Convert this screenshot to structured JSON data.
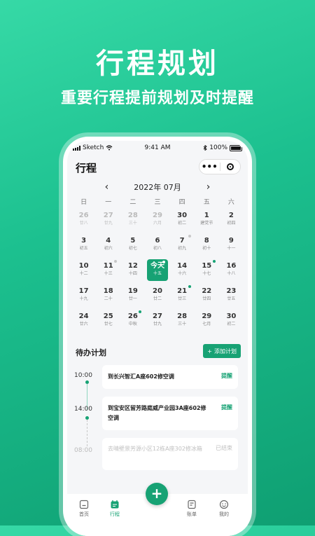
{
  "hero": {
    "title": "行程规划",
    "subtitle": "重要行程提前规划及时提醒"
  },
  "status_bar": {
    "carrier": "Sketch",
    "time": "9:41 AM",
    "battery": "100%"
  },
  "header": {
    "title": "行程",
    "more_icon": "more-dots-icon",
    "record_icon": "record-icon"
  },
  "calendar": {
    "month_label": "2022年 07月",
    "weekdays": [
      "日",
      "一",
      "二",
      "三",
      "四",
      "五",
      "六"
    ],
    "rows": [
      [
        {
          "n": "26",
          "l": "廿八"
        },
        {
          "n": "27",
          "l": "廿九"
        },
        {
          "n": "28",
          "l": "三十"
        },
        {
          "n": "29",
          "l": "六月"
        },
        {
          "n": "30",
          "l": "初二"
        },
        {
          "n": "1",
          "l": "建党节"
        },
        {
          "n": "2",
          "l": "初四"
        }
      ],
      [
        {
          "n": "3",
          "l": "初五"
        },
        {
          "n": "4",
          "l": "初六"
        },
        {
          "n": "5",
          "l": "初七"
        },
        {
          "n": "6",
          "l": "初八"
        },
        {
          "n": "7",
          "l": "初九"
        },
        {
          "n": "8",
          "l": "初十"
        },
        {
          "n": "9",
          "l": "十一"
        }
      ],
      [
        {
          "n": "10",
          "l": "十二"
        },
        {
          "n": "11",
          "l": "十三"
        },
        {
          "n": "12",
          "l": "十四"
        },
        {
          "n": "今天",
          "l": "十五"
        },
        {
          "n": "14",
          "l": "十六"
        },
        {
          "n": "15",
          "l": "十七"
        },
        {
          "n": "16",
          "l": "十八"
        }
      ],
      [
        {
          "n": "17",
          "l": "十九"
        },
        {
          "n": "18",
          "l": "二十"
        },
        {
          "n": "19",
          "l": "廿一"
        },
        {
          "n": "20",
          "l": "廿二"
        },
        {
          "n": "21",
          "l": "廿三"
        },
        {
          "n": "22",
          "l": "廿四"
        },
        {
          "n": "23",
          "l": "廿五"
        }
      ],
      [
        {
          "n": "24",
          "l": "廿六"
        },
        {
          "n": "25",
          "l": "廿七"
        },
        {
          "n": "26",
          "l": "中秋"
        },
        {
          "n": "27",
          "l": "廿九"
        },
        {
          "n": "28",
          "l": "三十"
        },
        {
          "n": "29",
          "l": "七月"
        },
        {
          "n": "30",
          "l": "初二"
        }
      ]
    ]
  },
  "plans": {
    "heading": "待办计划",
    "add_label": "添加计划",
    "items": [
      {
        "time": "10:00",
        "text": "到长兴智汇A座602修空调",
        "action": "提醒"
      },
      {
        "time": "14:00",
        "text": "到宝安区留芳路庭威产业园3A座602修空调",
        "action": "提醒"
      },
      {
        "time": "08:00",
        "text": "去晴壁景芳源小区12栋A座302修冰箱",
        "action": "已结束"
      }
    ]
  },
  "tabbar": {
    "tabs": [
      {
        "label": "首页",
        "icon": "home-icon"
      },
      {
        "label": "行程",
        "icon": "calendar-icon"
      },
      {
        "label": "账单",
        "icon": "bill-icon"
      },
      {
        "label": "我的",
        "icon": "smile-icon"
      }
    ],
    "fab_label": "+"
  },
  "colors": {
    "accent": "#17a274",
    "background": "#1cc08f"
  }
}
